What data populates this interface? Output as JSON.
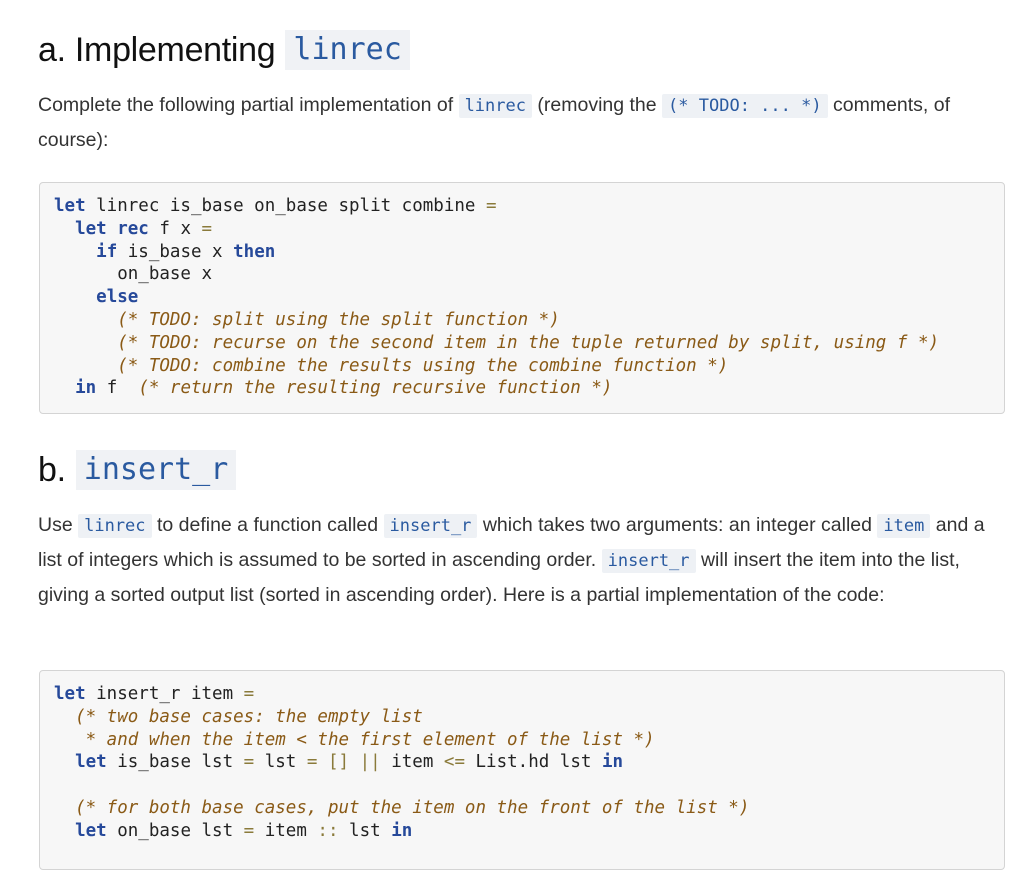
{
  "section_a": {
    "prefix": "a. Implementing",
    "code_name": "linrec",
    "intro_1": "Complete the following partial implementation of ",
    "intro_code_1": "linrec",
    "intro_2": " (removing the ",
    "intro_code_2": "(* TODO: ... *)",
    "intro_3": " comments, of course):",
    "code": {
      "l1_kw": "let",
      "l1_txt": " linrec is_base on_base split combine ",
      "l1_op": "=",
      "l2_kw1": "let",
      "l2_kw2": "rec",
      "l2_txt": " f x ",
      "l2_op": "=",
      "l3_kw1": "if",
      "l3_txt": " is_base x ",
      "l3_kw2": "then",
      "l4_txt": "on_base x",
      "l5_kw": "else",
      "l6_cm": "(* TODO: split using the split function *)",
      "l7_cm": "(* TODO: recurse on the second item in the tuple returned by split, using f *)",
      "l8_cm": "(* TODO: combine the results using the combine function *)",
      "l9_kw": "in",
      "l9_txt": " f  ",
      "l9_cm": "(* return the resulting recursive function *)"
    }
  },
  "section_b": {
    "prefix": "b.",
    "code_name": "insert_r",
    "p_1": "Use ",
    "p_code_1": "linrec",
    "p_2": " to define a function called ",
    "p_code_2": "insert_r",
    "p_3": " which takes two arguments: an integer called ",
    "p_code_3": "item",
    "p_4": " and a list of integers which is assumed to be sorted in ascending order. ",
    "p_code_4": "insert_r",
    "p_5": " will insert the item into the list, giving a sorted output list (sorted in ascending order). Here is a partial implementation of the code:",
    "code": {
      "l1_kw": "let",
      "l1_txt": " insert_r item ",
      "l1_op": "=",
      "l2_cm": "(* two base cases: the empty list",
      "l3_cm": " * and when the item < the first element of the list *)",
      "l4_kw1": "let",
      "l4_txt1": " is_base lst ",
      "l4_op1": "=",
      "l4_txt2": " lst ",
      "l4_op2": "=",
      "l4_txt3": " ",
      "l4_op3": "[]",
      "l4_txt4": " ",
      "l4_op4": "||",
      "l4_txt5": " item ",
      "l4_op5": "<=",
      "l4_txt6": " List.hd lst ",
      "l4_kw2": "in",
      "l6_cm": "(* for both base cases, put the item on the front of the list *)",
      "l7_kw1": "let",
      "l7_txt1": " on_base lst ",
      "l7_op1": "=",
      "l7_txt2": " item ",
      "l7_op2": "::",
      "l7_txt3": " lst ",
      "l7_kw2": "in"
    }
  }
}
